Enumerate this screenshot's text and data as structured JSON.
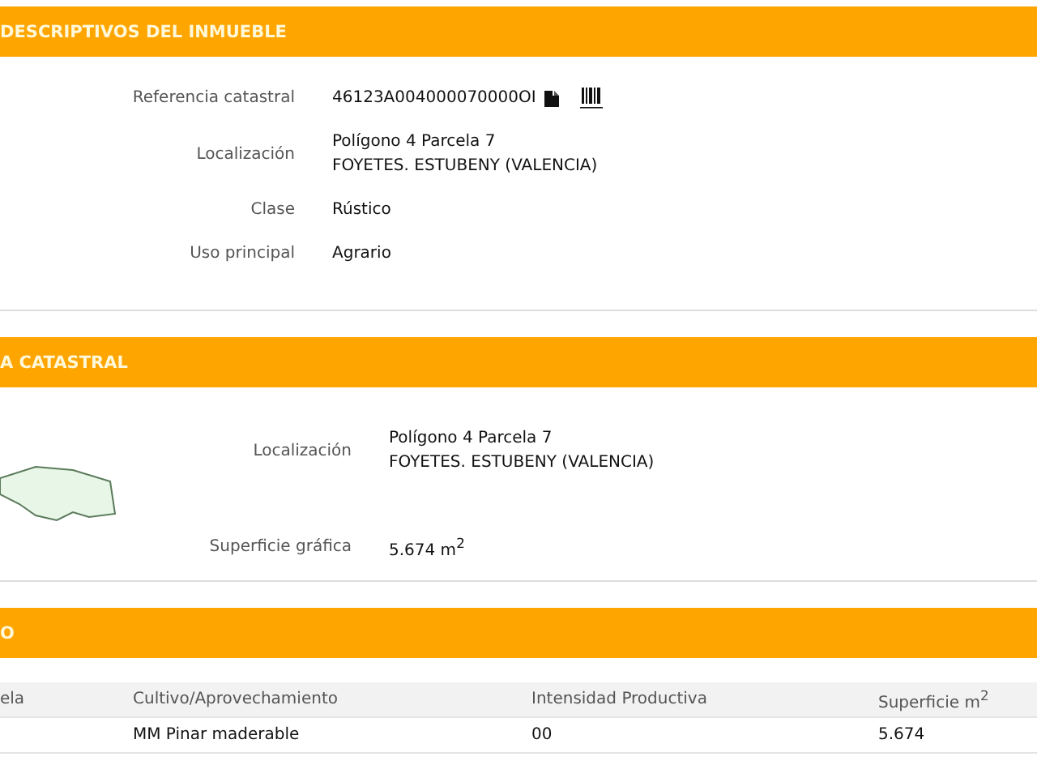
{
  "sections": [
    {
      "title": "DESCRIPTIVOS DEL INMUEBLE",
      "fields": [
        {
          "kind": "reference",
          "label": "Referencia catastral",
          "lines": [
            "46123A004000070000OI"
          ]
        },
        {
          "kind": "text",
          "label": "Localización",
          "lines": [
            "Polígono 4 Parcela 7",
            "FOYETES. ESTUBENY (VALENCIA)"
          ]
        },
        {
          "kind": "text",
          "label": "Clase",
          "lines": [
            "Rústico"
          ]
        },
        {
          "kind": "text",
          "label": "Uso principal",
          "lines": [
            "Agrario"
          ]
        }
      ]
    },
    {
      "title": "A CATASTRAL",
      "map": {
        "kind": "picture"
      },
      "fields": [
        {
          "kind": "text",
          "label": "Localización",
          "lines": [
            "Polígono 4 Parcela 7",
            "FOYETES. ESTUBENY (VALENCIA)"
          ]
        },
        {
          "kind": "text",
          "label": "Superficie gráfica",
          "lines": [
            "5.674 m$^{2}$"
          ]
        }
      ]
    },
    {
      "title": "O",
      "table": {
        "columns": [
          "ela",
          "Cultivo/Aprovechamiento",
          "Intensidad Productiva",
          "Superficie m$^{2}$"
        ],
        "rows": [
          [
            "",
            "MM Pinar maderable",
            "00",
            "5.674"
          ]
        ]
      }
    }
  ]
}
